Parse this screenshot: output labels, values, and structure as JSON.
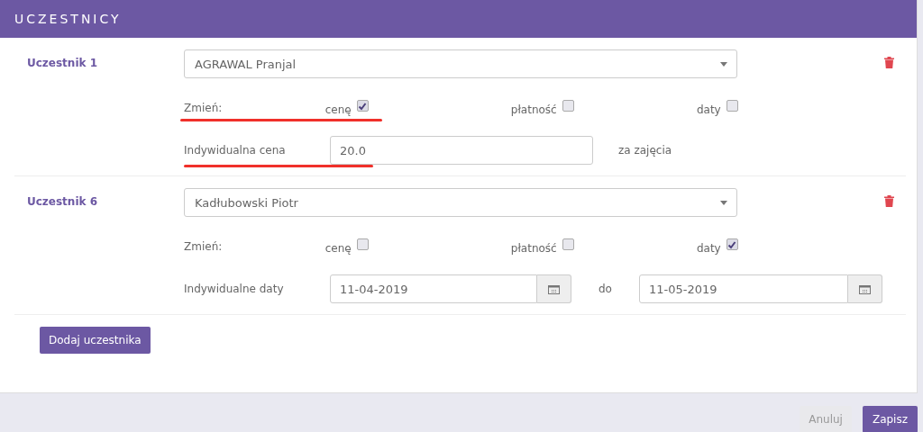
{
  "header": {
    "title": "UCZESTNICY"
  },
  "participants": [
    {
      "label": "Uczestnik 1",
      "select": {
        "value": "AGRAWAL Pranjal"
      },
      "changes": {
        "label": "Zmień:",
        "underlined": true,
        "options": [
          {
            "label": "cenę",
            "checked": true
          },
          {
            "label": "płatność",
            "checked": false
          },
          {
            "label": "daty",
            "checked": false
          }
        ]
      },
      "detail": {
        "kind": "price",
        "label": "Indywidualna cena",
        "underlined": true,
        "value": "20.0",
        "suffix": "za zajęcia"
      }
    },
    {
      "label": "Uczestnik 6",
      "select": {
        "value": "Kadłubowski Piotr"
      },
      "changes": {
        "label": "Zmień:",
        "underlined": false,
        "options": [
          {
            "label": "cenę",
            "checked": false
          },
          {
            "label": "płatność",
            "checked": false
          },
          {
            "label": "daty",
            "checked": true
          }
        ]
      },
      "detail": {
        "kind": "dates",
        "label": "Indywidualne daty",
        "from": "11-04-2019",
        "separator": "do",
        "to": "11-05-2019"
      }
    }
  ],
  "add_button": "Dodaj uczestnika",
  "footer": {
    "cancel": "Anuluj",
    "save": "Zapisz"
  }
}
